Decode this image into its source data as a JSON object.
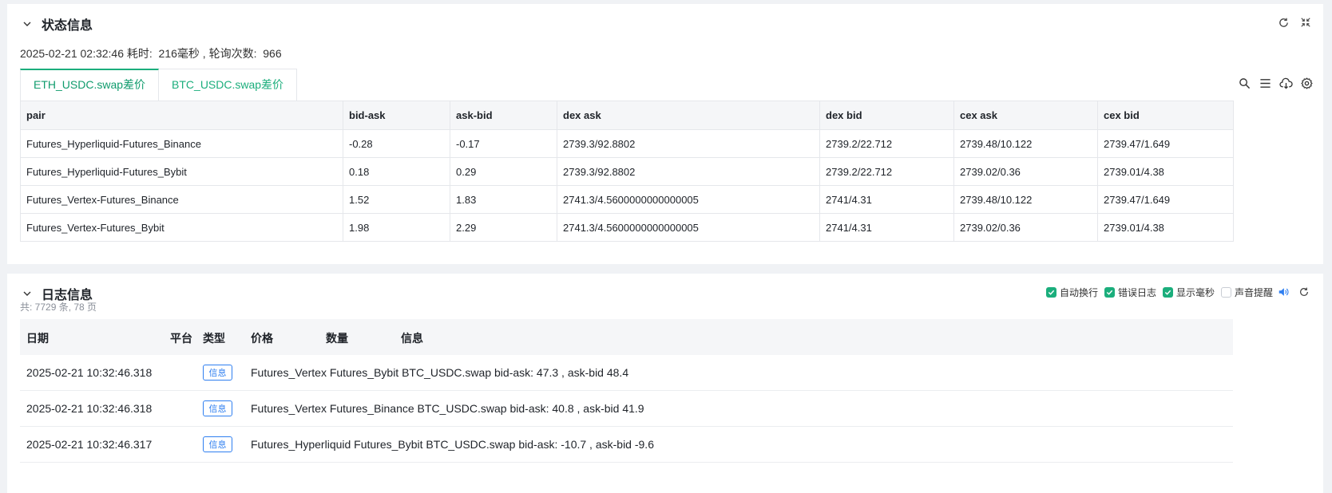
{
  "status_panel": {
    "title": "状态信息",
    "status_line": "2025-02-21 02:32:46 耗时:  216毫秒 , 轮询次数:  966",
    "tabs": [
      {
        "label": "ETH_USDC.swap差价",
        "active": true
      },
      {
        "label": "BTC_USDC.swap差价",
        "active": false
      }
    ],
    "table": {
      "headers": [
        "pair",
        "bid-ask",
        "ask-bid",
        "dex ask",
        "dex bid",
        "cex ask",
        "cex bid"
      ],
      "rows": [
        [
          "Futures_Hyperliquid-Futures_Binance",
          "-0.28",
          "-0.17",
          "2739.3/92.8802",
          "2739.2/22.712",
          "2739.48/10.122",
          "2739.47/1.649"
        ],
        [
          "Futures_Hyperliquid-Futures_Bybit",
          "0.18",
          "0.29",
          "2739.3/92.8802",
          "2739.2/22.712",
          "2739.02/0.36",
          "2739.01/4.38"
        ],
        [
          "Futures_Vertex-Futures_Binance",
          "1.52",
          "1.83",
          "2741.3/4.5600000000000005",
          "2741/4.31",
          "2739.48/10.122",
          "2739.47/1.649"
        ],
        [
          "Futures_Vertex-Futures_Bybit",
          "1.98",
          "2.29",
          "2741.3/4.5600000000000005",
          "2741/4.31",
          "2739.02/0.36",
          "2739.01/4.38"
        ]
      ]
    }
  },
  "log_panel": {
    "title": "日志信息",
    "controls": {
      "auto_wrap": {
        "label": "自动换行",
        "checked": true
      },
      "error_log": {
        "label": "错误日志",
        "checked": true
      },
      "show_ms": {
        "label": "显示毫秒",
        "checked": true
      },
      "sound_alert": {
        "label": "声音提醒",
        "checked": false
      }
    },
    "count": "共: 7729 条, 78 页",
    "headers": {
      "date": "日期",
      "platform": "平台",
      "type": "类型",
      "price": "价格",
      "amount": "数量",
      "info": "信息"
    },
    "rows": [
      {
        "date": "2025-02-21 10:32:46.318",
        "type": "信息",
        "message": "Futures_Vertex Futures_Bybit BTC_USDC.swap bid-ask: 47.3 , ask-bid 48.4"
      },
      {
        "date": "2025-02-21 10:32:46.318",
        "type": "信息",
        "message": "Futures_Vertex Futures_Binance BTC_USDC.swap bid-ask: 40.8 , ask-bid 41.9"
      },
      {
        "date": "2025-02-21 10:32:46.317",
        "type": "信息",
        "message": "Futures_Hyperliquid Futures_Bybit BTC_USDC.swap bid-ask: -10.7 , ask-bid -9.6"
      }
    ]
  },
  "colors": {
    "accent": "#1bae7c",
    "info_badge": "#2f7ff0",
    "sound_icon": "#2f7ff0"
  },
  "icons": [
    "chevron-down-icon",
    "refresh-icon",
    "fullscreen-icon",
    "search-icon",
    "columns-icon",
    "cloud-download-icon",
    "settings-icon",
    "check-icon",
    "speaker-icon"
  ]
}
